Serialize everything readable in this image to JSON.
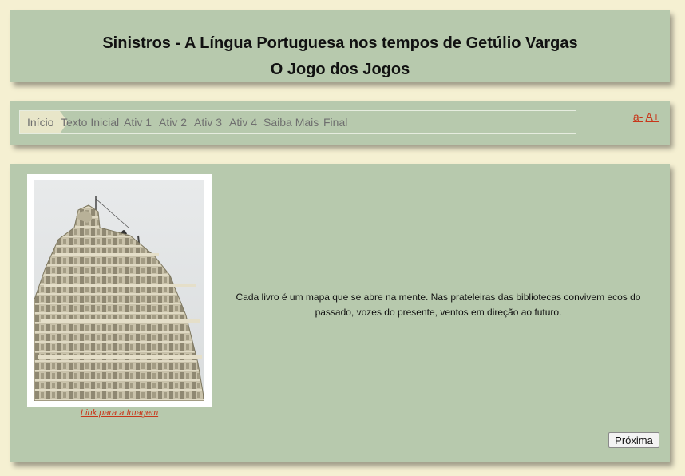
{
  "header": {
    "title": "Sinistros - A Língua Portuguesa nos tempos de Getúlio Vargas",
    "subtitle": "O Jogo dos Jogos"
  },
  "nav": {
    "breadcrumbs": [
      {
        "label": "Início",
        "current": true
      },
      {
        "label": "Texto Inicial"
      },
      {
        "label": "Ativ 1"
      },
      {
        "label": "Ativ 2"
      },
      {
        "label": "Ativ 3"
      },
      {
        "label": "Ativ 4"
      },
      {
        "label": "Saiba Mais"
      },
      {
        "label": "Final"
      }
    ],
    "font_decrease": "a-",
    "font_increase": "A+"
  },
  "content": {
    "image_icon": "temple-tower-photo",
    "image_link": "Link para a Imagem",
    "text": "Cada livro é um mapa que se abre na mente. Nas prateleiras das bibliotecas convivem ecos do passado, vozes do presente, ventos em direção ao futuro.",
    "next_label": "Próxima"
  },
  "colors": {
    "page_background": "#f5f0d2",
    "panel": "#b7c9ad",
    "link": "#c8361a",
    "current_crumb": "#e8e6c9"
  }
}
